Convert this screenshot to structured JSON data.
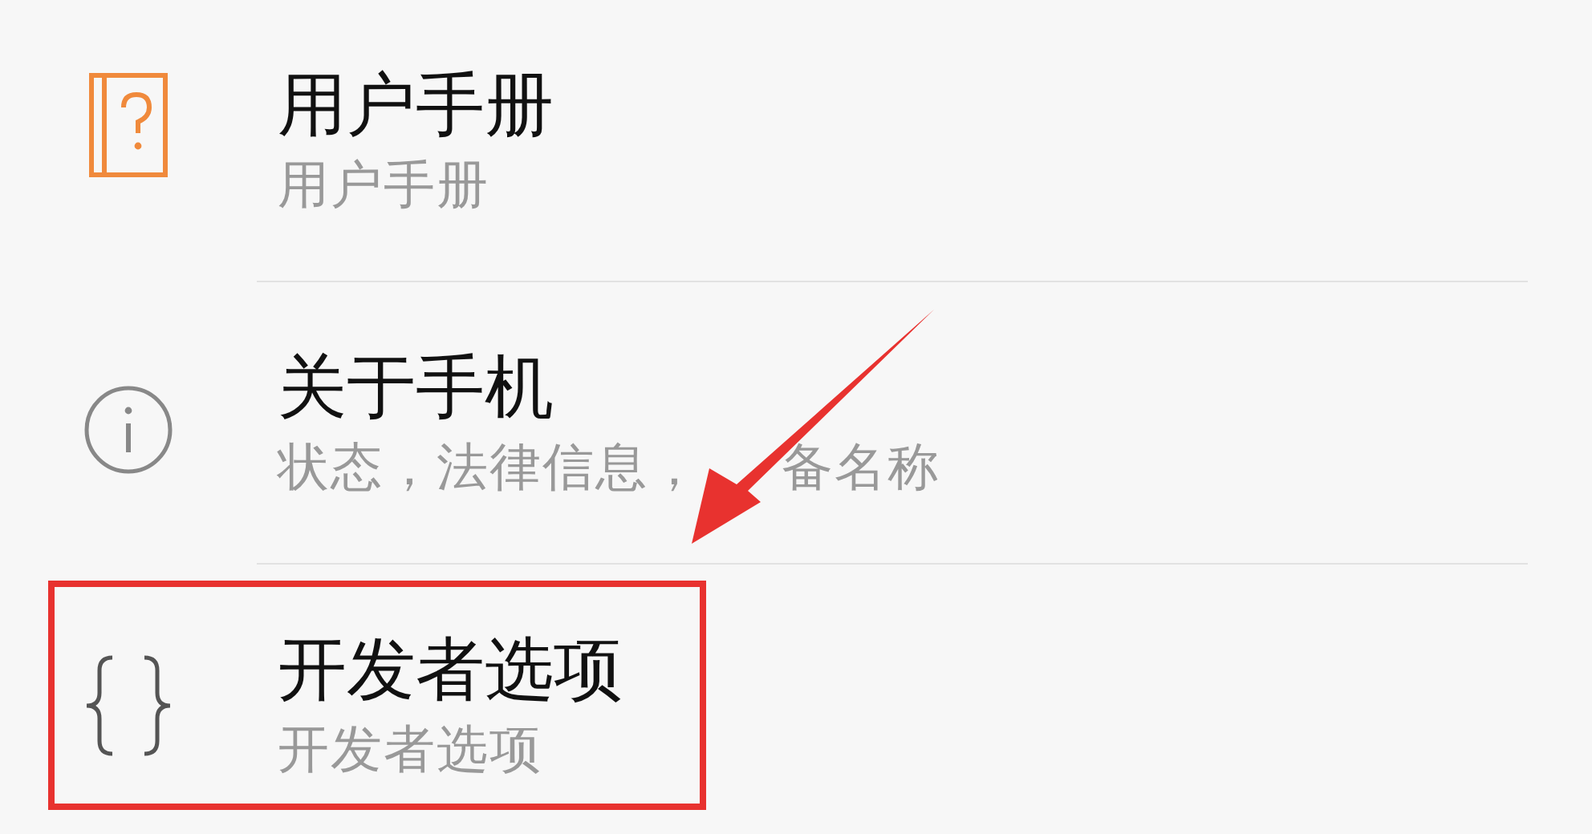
{
  "items": [
    {
      "kind": "manual",
      "title": "用户手册",
      "subtitle": "用户手册",
      "highlighted": false
    },
    {
      "kind": "about",
      "title": "关于手机",
      "subtitle": "状态，法律信息，",
      "subtitle_after_arrow": "备名称",
      "highlighted": false
    },
    {
      "kind": "developer",
      "title": "开发者选项",
      "subtitle": "开发者选项",
      "highlighted": true
    }
  ]
}
